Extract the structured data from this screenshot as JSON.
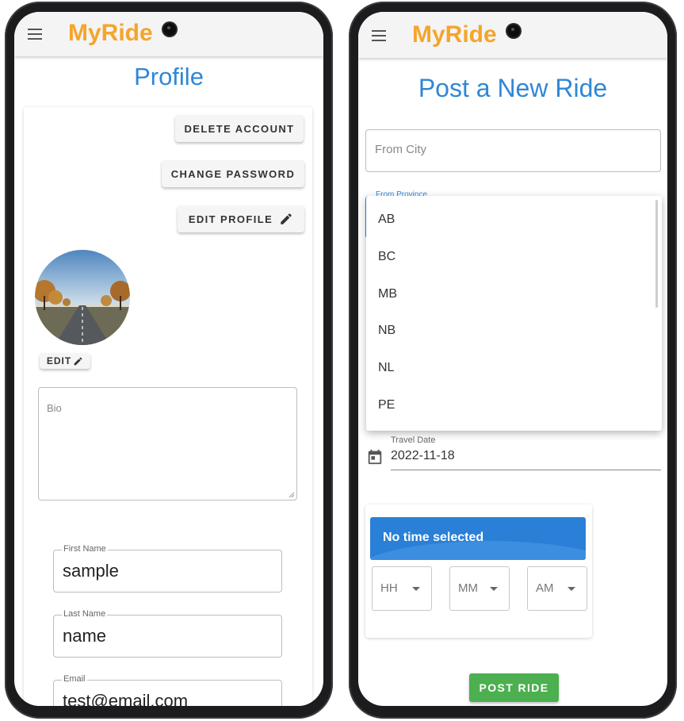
{
  "left": {
    "app_title": "MyRide",
    "page_title": "Profile",
    "buttons": {
      "delete_account": "DELETE ACCOUNT",
      "change_password": "CHANGE PASSWORD",
      "edit_profile": "EDIT PROFILE",
      "edit_avatar": "EDIT"
    },
    "bio": {
      "placeholder": "Bio"
    },
    "fields": {
      "first_name": {
        "label": "First Name",
        "value": "sample"
      },
      "last_name": {
        "label": "Last Name",
        "value": "name"
      },
      "email": {
        "label": "Email",
        "value": "test@email.com"
      }
    }
  },
  "right": {
    "app_title": "MyRide",
    "page_title": "Post a New Ride",
    "from_city": {
      "placeholder": "From City"
    },
    "from_province": {
      "label": "From Province"
    },
    "province_options": [
      "AB",
      "BC",
      "MB",
      "NB",
      "NL",
      "PE"
    ],
    "travel_date": {
      "label": "Travel Date",
      "value": "2022-11-18"
    },
    "time_picker": {
      "header": "No time selected",
      "hour": "HH",
      "minute": "MM",
      "period": "AM"
    },
    "post_button": "POST RIDE"
  },
  "colors": {
    "brand_orange": "#f5a52a",
    "title_blue": "#2f87d7",
    "header_blue": "#2a7fd6",
    "post_green": "#4caf50"
  },
  "icons": [
    "menu-icon",
    "pencil-icon",
    "calendar-icon",
    "caret-down-icon"
  ]
}
